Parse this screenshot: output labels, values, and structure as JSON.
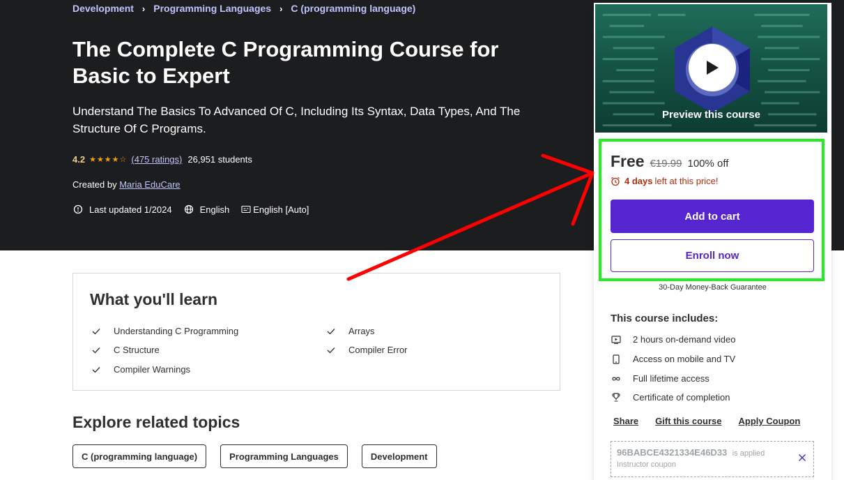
{
  "breadcrumb": {
    "items": [
      "Development",
      "Programming Languages",
      "C (programming language)"
    ],
    "separator": "›"
  },
  "course": {
    "title": "The Complete C Programming Course for Basic to Expert",
    "subtitle": "Understand The Basics To Advanced Of C, Including Its Syntax, Data Types, And The Structure Of C Programs.",
    "rating": "4.2",
    "stars": "★★★★☆",
    "ratings_count": "(475 ratings)",
    "students": "26,951 students",
    "created_by_label": "Created by",
    "instructor": "Maria EduCare",
    "last_updated": "Last updated 1/2024",
    "language": "English",
    "captions": "English [Auto]"
  },
  "learn": {
    "title": "What you'll learn",
    "items": [
      "Understanding C Programming",
      "Arrays",
      "C Structure",
      "Compiler Error",
      "Compiler Warnings"
    ]
  },
  "related": {
    "title": "Explore related topics",
    "topics": [
      "C (programming language)",
      "Programming Languages",
      "Development"
    ]
  },
  "sidebar": {
    "preview_label": "Preview this course",
    "price": "Free",
    "original_price": "€19.99",
    "discount": "100% off",
    "deadline_bold": "4 days",
    "deadline_rest": "left at this price!",
    "add_to_cart": "Add to cart",
    "enroll_now": "Enroll now",
    "guarantee": "30-Day Money-Back Guarantee",
    "includes_title": "This course includes:",
    "includes": [
      {
        "icon": "video-icon",
        "label": "2 hours on-demand video"
      },
      {
        "icon": "mobile-icon",
        "label": "Access on mobile and TV"
      },
      {
        "icon": "infinity-icon",
        "label": "Full lifetime access"
      },
      {
        "icon": "trophy-icon",
        "label": "Certificate of completion"
      }
    ],
    "links": [
      "Share",
      "Gift this course",
      "Apply Coupon"
    ],
    "coupon_code": "96BABCE4321334E46D33",
    "coupon_applied": "is applied",
    "coupon_label": "Instructor coupon"
  },
  "colors": {
    "hero_bg": "#1c1d1f",
    "accent_purple": "#5624d0",
    "link_lavender": "#c0c4fc",
    "star_orange": "#f69c08",
    "deadline_red": "#b32d0f",
    "annotation_red": "#ff0000",
    "annotation_green": "#22ee22"
  }
}
